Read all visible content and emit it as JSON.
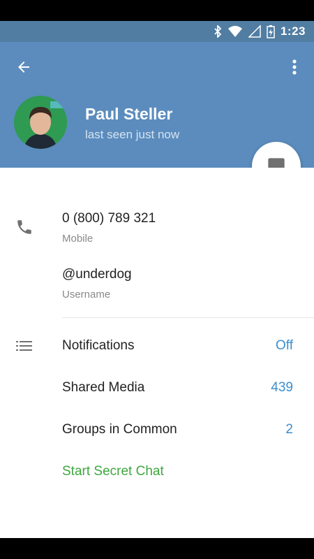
{
  "status": {
    "time": "1:23"
  },
  "header": {
    "name": "Paul Steller",
    "subtitle": "last seen just now"
  },
  "info": {
    "phone": {
      "value": "0 (800) 789 321",
      "label": "Mobile"
    },
    "username": {
      "value": "@underdog",
      "label": "Username"
    }
  },
  "settings": [
    {
      "label": "Notifications",
      "value": "Off"
    },
    {
      "label": "Shared Media",
      "value": "439"
    },
    {
      "label": "Groups in Common",
      "value": "2"
    }
  ],
  "secret_chat": "Start Secret Chat",
  "colors": {
    "header": "#5b8cbd",
    "statusbar": "#517da2",
    "accent": "#3a8fd0",
    "secret": "#3fa73f"
  },
  "icons": [
    "back-arrow-icon",
    "more-vert-icon",
    "message-icon",
    "phone-icon",
    "list-icon"
  ]
}
